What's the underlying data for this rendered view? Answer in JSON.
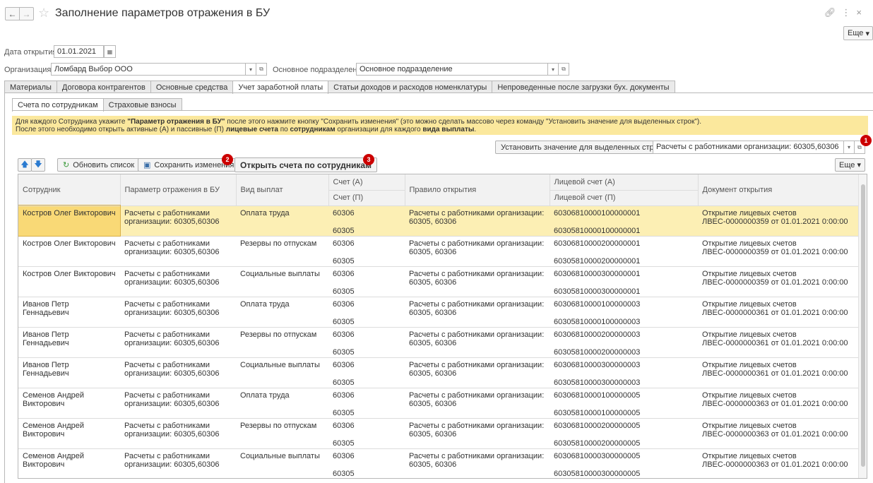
{
  "window": {
    "title": "Заполнение параметров отражения в БУ",
    "more_label": "Еще"
  },
  "form": {
    "date_label": "Дата открытия:",
    "date_value": "01.01.2021",
    "org_label": "Организация:",
    "org_value": "Ломбард Выбор ООО",
    "dept_label": "Основное подразделение:",
    "dept_value": "Основное подразделение"
  },
  "tabs": [
    {
      "label": "Материалы"
    },
    {
      "label": "Договора контрагентов"
    },
    {
      "label": "Основные средства"
    },
    {
      "label": "Учет заработной платы"
    },
    {
      "label": "Статьи доходов и расходов номенклатуры"
    },
    {
      "label": "Непроведенные после загрузки бух. документы"
    }
  ],
  "subtabs": [
    {
      "label": "Счета по сотрудникам"
    },
    {
      "label": "Страховые взносы"
    }
  ],
  "info": {
    "l1_a": "Для каждого Сотрудника укажите ",
    "l1_b": "\"Параметр отражения в БУ\"",
    "l1_c": " после этого нажмите кнопку \"Сохранить изменения\" (это можно сделать массово через команду \"Установить значение для выделенных строк\").",
    "l2_a": "После этого необходимо открыть активные (А) и пассивные (П) ",
    "l2_b": "лицевые счета",
    "l2_c": " по ",
    "l2_d": "сотрудникам",
    "l2_e": " организации для каждого ",
    "l2_f": "вида выплаты",
    "l2_g": "."
  },
  "toolbar": {
    "set_value_label": "Установить значение для выделенных строк",
    "param_value": "Расчеты с работниками организации: 60305,60306",
    "refresh_label": "Обновить список",
    "save_label": "Сохранить изменения",
    "open_label": "Открыть счета по сотрудникам",
    "more_label": "Еще",
    "badges": [
      "1",
      "2",
      "3"
    ]
  },
  "table": {
    "headers": {
      "employee": "Сотрудник",
      "param": "Параметр отражения в БУ",
      "kind": "Вид выплат",
      "acc_a": "Счет (А)",
      "acc_p": "Счет (П)",
      "rule": "Правило открытия",
      "pacc_a": "Лицевой счет (А)",
      "pacc_p": "Лицевой счет (П)",
      "doc": "Документ открытия"
    },
    "rows": [
      {
        "employee": "Костров Олег Викторович",
        "param": "Расчеты с работниками организации: 60305,60306",
        "kind": "Оплата труда",
        "acc_a": "60306",
        "acc_p": "60305",
        "rule": "Расчеты с работниками организации: 60305, 60306",
        "pacc_a": "60306810000100000001",
        "pacc_p": "60305810000100000001",
        "doc": "Открытие лицевых счетов ЛВЕС-0000000359 от 01.01.2021 0:00:00"
      },
      {
        "employee": "Костров Олег Викторович",
        "param": "Расчеты с работниками организации: 60305,60306",
        "kind": "Резервы по отпускам",
        "acc_a": "60306",
        "acc_p": "60305",
        "rule": "Расчеты с работниками организации: 60305, 60306",
        "pacc_a": "60306810000200000001",
        "pacc_p": "60305810000200000001",
        "doc": "Открытие лицевых счетов ЛВЕС-0000000359 от 01.01.2021 0:00:00"
      },
      {
        "employee": "Костров Олег Викторович",
        "param": "Расчеты с работниками организации: 60305,60306",
        "kind": "Социальные выплаты",
        "acc_a": "60306",
        "acc_p": "60305",
        "rule": "Расчеты с работниками организации: 60305, 60306",
        "pacc_a": "60306810000300000001",
        "pacc_p": "60305810000300000001",
        "doc": "Открытие лицевых счетов ЛВЕС-0000000359 от 01.01.2021 0:00:00"
      },
      {
        "employee": "Иванов Петр Геннадьевич",
        "param": "Расчеты с работниками организации: 60305,60306",
        "kind": "Оплата труда",
        "acc_a": "60306",
        "acc_p": "60305",
        "rule": "Расчеты с работниками организации: 60305, 60306",
        "pacc_a": "60306810000100000003",
        "pacc_p": "60305810000100000003",
        "doc": "Открытие лицевых счетов ЛВЕС-0000000361 от 01.01.2021 0:00:00"
      },
      {
        "employee": "Иванов Петр Геннадьевич",
        "param": "Расчеты с работниками организации: 60305,60306",
        "kind": "Резервы по отпускам",
        "acc_a": "60306",
        "acc_p": "60305",
        "rule": "Расчеты с работниками организации: 60305, 60306",
        "pacc_a": "60306810000200000003",
        "pacc_p": "60305810000200000003",
        "doc": "Открытие лицевых счетов ЛВЕС-0000000361 от 01.01.2021 0:00:00"
      },
      {
        "employee": "Иванов Петр Геннадьевич",
        "param": "Расчеты с работниками организации: 60305,60306",
        "kind": "Социальные выплаты",
        "acc_a": "60306",
        "acc_p": "60305",
        "rule": "Расчеты с работниками организации: 60305, 60306",
        "pacc_a": "60306810000300000003",
        "pacc_p": "60305810000300000003",
        "doc": "Открытие лицевых счетов ЛВЕС-0000000361 от 01.01.2021 0:00:00"
      },
      {
        "employee": "Семенов Андрей Викторович",
        "param": "Расчеты с работниками организации: 60305,60306",
        "kind": "Оплата труда",
        "acc_a": "60306",
        "acc_p": "60305",
        "rule": "Расчеты с работниками организации: 60305, 60306",
        "pacc_a": "60306810000100000005",
        "pacc_p": "60305810000100000005",
        "doc": "Открытие лицевых счетов ЛВЕС-0000000363 от 01.01.2021 0:00:00"
      },
      {
        "employee": "Семенов Андрей Викторович",
        "param": "Расчеты с работниками организации: 60305,60306",
        "kind": "Резервы по отпускам",
        "acc_a": "60306",
        "acc_p": "60305",
        "rule": "Расчеты с работниками организации: 60305, 60306",
        "pacc_a": "60306810000200000005",
        "pacc_p": "60305810000200000005",
        "doc": "Открытие лицевых счетов ЛВЕС-0000000363 от 01.01.2021 0:00:00"
      },
      {
        "employee": "Семенов Андрей Викторович",
        "param": "Расчеты с работниками организации: 60305,60306",
        "kind": "Социальные выплаты",
        "acc_a": "60306",
        "acc_p": "60305",
        "rule": "Расчеты с работниками организации: 60305, 60306",
        "pacc_a": "60306810000300000005",
        "pacc_p": "60305810000300000005",
        "doc": "Открытие лицевых счетов ЛВЕС-0000000363 от 01.01.2021 0:00:00"
      }
    ]
  }
}
